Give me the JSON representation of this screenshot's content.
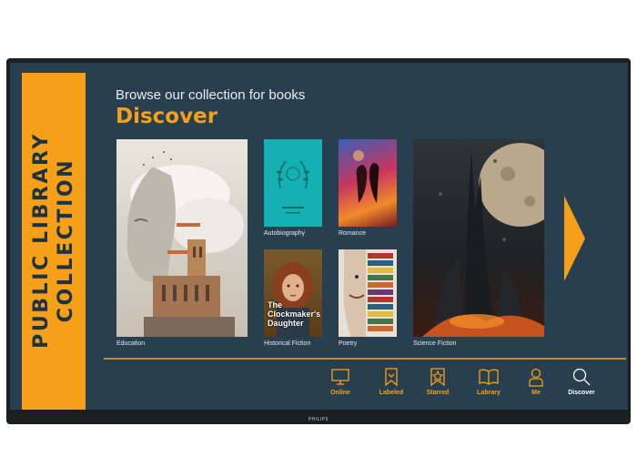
{
  "device": {
    "brand": "PHILIPS"
  },
  "sidebar": {
    "title": "PUBLIC LIBRARY COLLECTION"
  },
  "header": {
    "subtitle": "Browse our collection for books",
    "title": "Discover"
  },
  "categories": [
    {
      "label": "Education",
      "image": "woman-clouds-architecture-art"
    },
    {
      "label": "Autobiography",
      "image": "teal-cover-laurel-wreath"
    },
    {
      "label": "Romance",
      "image": "couple-silhouette-colorful-art"
    },
    {
      "label": "Historical Fiction",
      "image": "girl-portrait-cover",
      "cover_text": "The Clockmaker's Daughter"
    },
    {
      "label": "Poetry",
      "image": "face-collage-books"
    },
    {
      "label": "Science Fiction",
      "image": "dark-tower-planet-art"
    }
  ],
  "next_arrow": {
    "icon": "chevron-right-triangle-icon"
  },
  "nav": [
    {
      "label": "Online",
      "icon": "monitor-icon"
    },
    {
      "label": "Labeled",
      "icon": "bookmark-icon"
    },
    {
      "label": "Starred",
      "icon": "star-bookmark-icon"
    },
    {
      "label": "Labrary",
      "icon": "open-book-icon"
    },
    {
      "label": "Me",
      "icon": "user-icon"
    },
    {
      "label": "Discover",
      "icon": "search-icon",
      "active": true
    }
  ],
  "colors": {
    "accent": "#f6a01a",
    "screen_bg": "#283f50",
    "text_light": "#e8edf1"
  }
}
